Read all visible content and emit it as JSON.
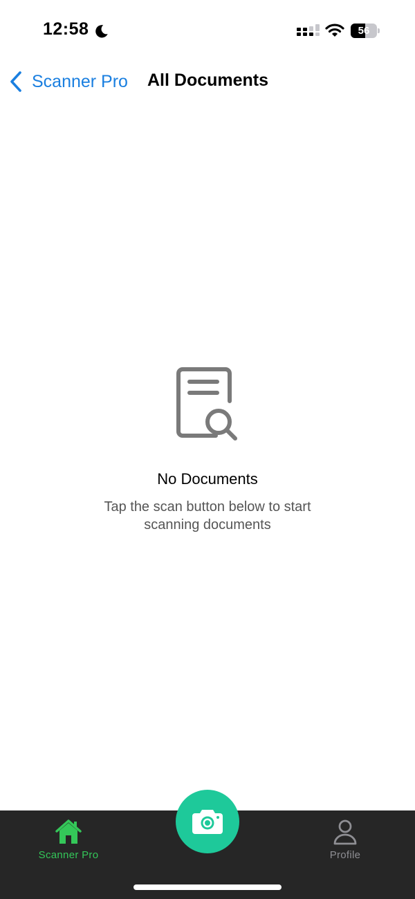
{
  "status_bar": {
    "time": "12:58",
    "battery_level": "56",
    "battery_fraction": 0.56,
    "icons": [
      "moon-icon",
      "signal-icon",
      "wifi-icon",
      "battery-icon"
    ]
  },
  "nav": {
    "back_label": "Scanner Pro",
    "title": "All Documents"
  },
  "empty_state": {
    "icon": "document-search-icon",
    "title": "No Documents",
    "subtitle": "Tap the scan button below to start scanning documents"
  },
  "tab_bar": {
    "home_label": "Scanner Pro",
    "profile_label": "Profile",
    "scan_icon": "camera-icon"
  },
  "colors": {
    "accent_blue": "#1a7fe0",
    "active_tab_green": "#34c759",
    "scan_button": "#1ec99a",
    "tab_bar_bg": "#262626",
    "inactive_tab": "#8e8e93"
  }
}
